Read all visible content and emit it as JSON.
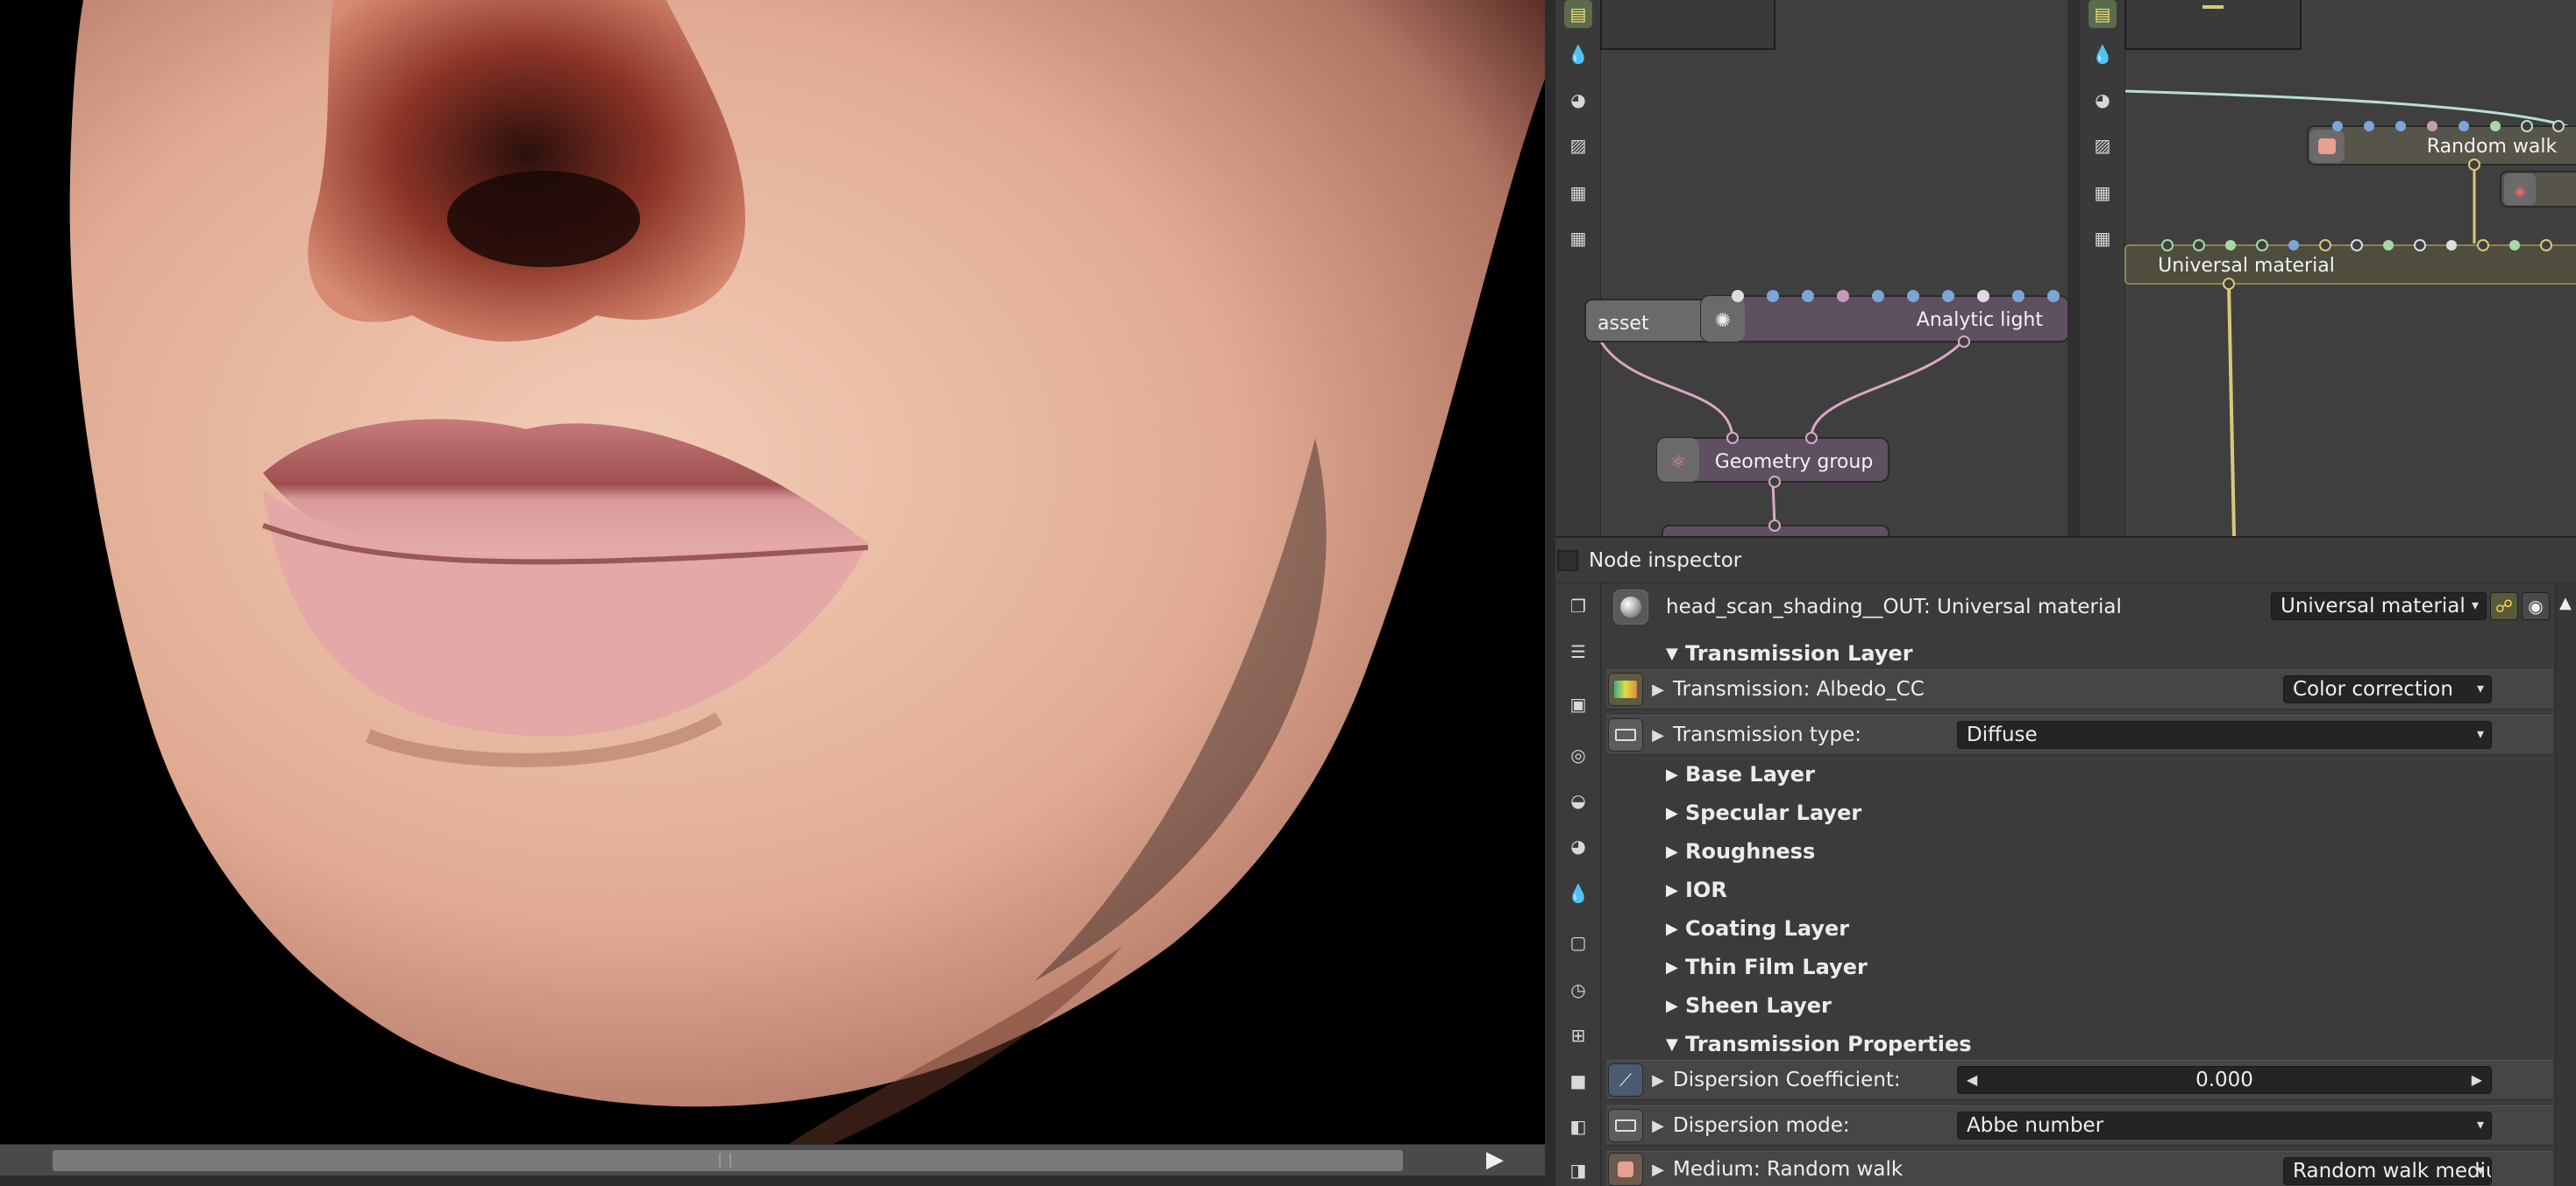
{
  "viewport": {
    "status_text": "",
    "play_icon": "play-icon"
  },
  "graph_left": {
    "nodes": [
      {
        "label": "asset"
      },
      {
        "label": "Analytic light"
      },
      {
        "label": "Geometry group"
      }
    ]
  },
  "graph_right": {
    "nodes": [
      {
        "label": "Random walk"
      },
      {
        "label": "Universal material"
      }
    ]
  },
  "inspector": {
    "title": "Node inspector",
    "node_path": "head_scan_shading__OUT: Universal material",
    "node_type": "Universal material",
    "sections": {
      "transmission_layer": "Transmission Layer",
      "base_layer": "Base Layer",
      "specular_layer": "Specular Layer",
      "roughness": "Roughness",
      "ior": "IOR",
      "coating_layer": "Coating Layer",
      "thin_film_layer": "Thin Film Layer",
      "sheen_layer": "Sheen Layer",
      "transmission_properties": "Transmission Properties"
    },
    "params": {
      "transmission": {
        "label": "Transmission: Albedo_CC",
        "value": "Color correction"
      },
      "transmission_type": {
        "label": "Transmission type:",
        "value": "Diffuse"
      },
      "dispersion_coefficient": {
        "label": "Dispersion Coefficient:",
        "value": "0.000"
      },
      "dispersion_mode": {
        "label": "Dispersion mode:",
        "value": "Abbe number"
      },
      "medium": {
        "label": "Medium: Random walk",
        "value": "Random walk medium"
      }
    }
  },
  "colors": {
    "accent_yellow": "#d8c878",
    "link_pink": "#d8a8c8",
    "link_cyan": "#b8e0d0"
  }
}
